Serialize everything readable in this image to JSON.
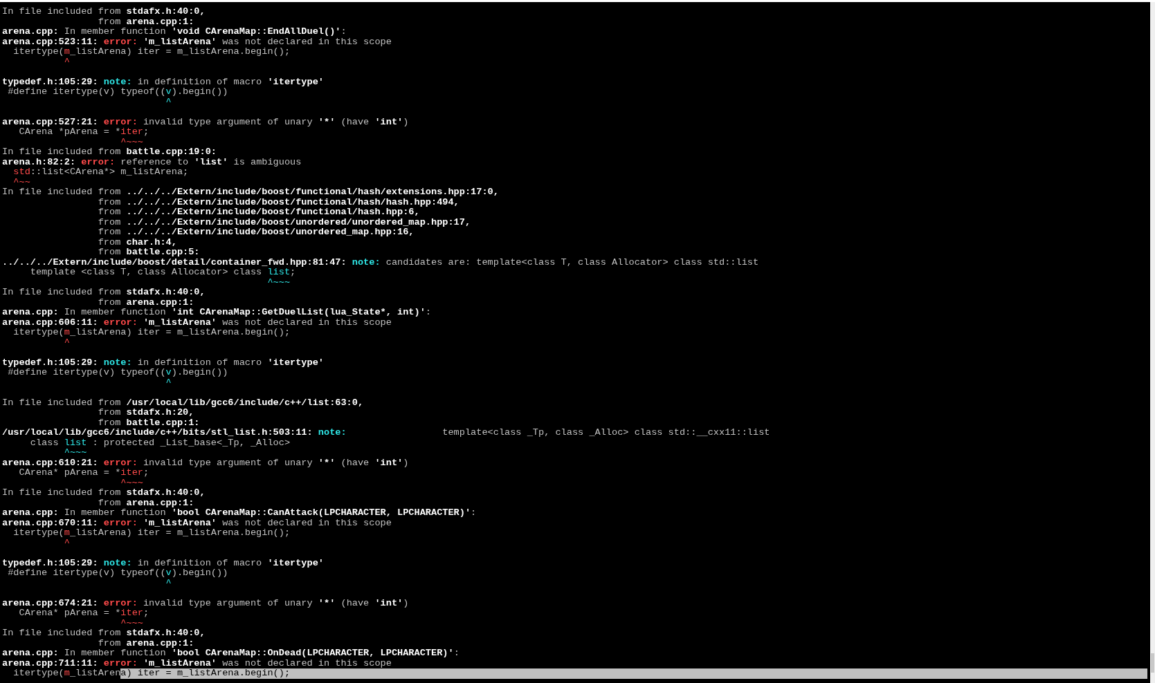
{
  "terminal": {
    "lines": [
      {
        "kind": "text",
        "spans": [
          {
            "kind": "plain",
            "text": "In file included from "
          },
          {
            "kind": "bold",
            "text": "stdafx.h:40:0,"
          }
        ]
      },
      {
        "kind": "text",
        "spans": [
          {
            "kind": "plain",
            "text": "                 from "
          },
          {
            "kind": "bold",
            "text": "arena.cpp:1:"
          }
        ]
      },
      {
        "kind": "text",
        "spans": [
          {
            "kind": "bold",
            "text": "arena.cpp:"
          },
          {
            "kind": "plain",
            "text": " In member function "
          },
          {
            "kind": "bold",
            "text": "'void CArenaMap::EndAllDuel()'"
          },
          {
            "kind": "plain",
            "text": ":"
          }
        ]
      },
      {
        "kind": "text",
        "spans": [
          {
            "kind": "bold",
            "text": "arena.cpp:523:11: "
          },
          {
            "kind": "error",
            "text": "error: "
          },
          {
            "kind": "bold",
            "text": "'m_listArena'"
          },
          {
            "kind": "plain",
            "text": " was not declared in this scope"
          }
        ]
      },
      {
        "kind": "text",
        "spans": [
          {
            "kind": "plain",
            "text": "  itertype("
          },
          {
            "kind": "red",
            "text": "m"
          },
          {
            "kind": "plain",
            "text": "_listArena) iter = m_listArena.begin();"
          }
        ]
      },
      {
        "kind": "text",
        "spans": [
          {
            "kind": "red",
            "text": "           ^"
          }
        ]
      },
      {
        "kind": "blank"
      },
      {
        "kind": "text",
        "spans": [
          {
            "kind": "bold",
            "text": "typedef.h:105:29: "
          },
          {
            "kind": "note",
            "text": "note: "
          },
          {
            "kind": "plain",
            "text": "in definition of macro "
          },
          {
            "kind": "bold",
            "text": "'itertype'"
          }
        ]
      },
      {
        "kind": "text",
        "spans": [
          {
            "kind": "plain",
            "text": " #define itertype(v) typeof(("
          },
          {
            "kind": "cyan",
            "text": "v"
          },
          {
            "kind": "plain",
            "text": ").begin())"
          }
        ]
      },
      {
        "kind": "text",
        "spans": [
          {
            "kind": "cyan",
            "text": "                             ^"
          }
        ]
      },
      {
        "kind": "blank"
      },
      {
        "kind": "text",
        "spans": [
          {
            "kind": "bold",
            "text": "arena.cpp:527:21: "
          },
          {
            "kind": "error",
            "text": "error: "
          },
          {
            "kind": "plain",
            "text": "invalid type argument of unary "
          },
          {
            "kind": "bold",
            "text": "'*'"
          },
          {
            "kind": "plain",
            "text": " (have "
          },
          {
            "kind": "bold",
            "text": "'int'"
          },
          {
            "kind": "plain",
            "text": ")"
          }
        ]
      },
      {
        "kind": "text",
        "spans": [
          {
            "kind": "plain",
            "text": "   CArena *pArena = *"
          },
          {
            "kind": "red",
            "text": "iter"
          },
          {
            "kind": "plain",
            "text": ";"
          }
        ]
      },
      {
        "kind": "text",
        "spans": [
          {
            "kind": "red",
            "text": "                     ^~~~"
          }
        ]
      },
      {
        "kind": "text",
        "spans": [
          {
            "kind": "plain",
            "text": "In file included from "
          },
          {
            "kind": "bold",
            "text": "battle.cpp:19:0:"
          }
        ]
      },
      {
        "kind": "text",
        "spans": [
          {
            "kind": "bold",
            "text": "arena.h:82:2: "
          },
          {
            "kind": "error",
            "text": "error: "
          },
          {
            "kind": "plain",
            "text": "reference to "
          },
          {
            "kind": "bold",
            "text": "'list'"
          },
          {
            "kind": "plain",
            "text": " is ambiguous"
          }
        ]
      },
      {
        "kind": "text",
        "spans": [
          {
            "kind": "red",
            "text": "  std"
          },
          {
            "kind": "plain",
            "text": "::list<CArena*> m_listArena;"
          }
        ]
      },
      {
        "kind": "text",
        "spans": [
          {
            "kind": "red",
            "text": "  ^~~"
          }
        ]
      },
      {
        "kind": "text",
        "spans": [
          {
            "kind": "plain",
            "text": "In file included from "
          },
          {
            "kind": "bold",
            "text": "../../../Extern/include/boost/functional/hash/extensions.hpp:17:0,"
          }
        ]
      },
      {
        "kind": "text",
        "spans": [
          {
            "kind": "plain",
            "text": "                 from "
          },
          {
            "kind": "bold",
            "text": "../../../Extern/include/boost/functional/hash/hash.hpp:494,"
          }
        ]
      },
      {
        "kind": "text",
        "spans": [
          {
            "kind": "plain",
            "text": "                 from "
          },
          {
            "kind": "bold",
            "text": "../../../Extern/include/boost/functional/hash.hpp:6,"
          }
        ]
      },
      {
        "kind": "text",
        "spans": [
          {
            "kind": "plain",
            "text": "                 from "
          },
          {
            "kind": "bold",
            "text": "../../../Extern/include/boost/unordered/unordered_map.hpp:17,"
          }
        ]
      },
      {
        "kind": "text",
        "spans": [
          {
            "kind": "plain",
            "text": "                 from "
          },
          {
            "kind": "bold",
            "text": "../../../Extern/include/boost/unordered_map.hpp:16,"
          }
        ]
      },
      {
        "kind": "text",
        "spans": [
          {
            "kind": "plain",
            "text": "                 from "
          },
          {
            "kind": "bold",
            "text": "char.h:4,"
          }
        ]
      },
      {
        "kind": "text",
        "spans": [
          {
            "kind": "plain",
            "text": "                 from "
          },
          {
            "kind": "bold",
            "text": "battle.cpp:5:"
          }
        ]
      },
      {
        "kind": "text",
        "spans": [
          {
            "kind": "bold",
            "text": "../../../Extern/include/boost/detail/container_fwd.hpp:81:47: "
          },
          {
            "kind": "note",
            "text": "note: "
          },
          {
            "kind": "plain",
            "text": "candidates are: template<class T, class Allocator> class std::list"
          }
        ]
      },
      {
        "kind": "text",
        "spans": [
          {
            "kind": "plain",
            "text": "     template <class T, class Allocator> class "
          },
          {
            "kind": "cyan",
            "text": "list"
          },
          {
            "kind": "plain",
            "text": ";"
          }
        ]
      },
      {
        "kind": "text",
        "spans": [
          {
            "kind": "cyan",
            "text": "                                               ^~~~"
          }
        ]
      },
      {
        "kind": "text",
        "spans": [
          {
            "kind": "plain",
            "text": "In file included from "
          },
          {
            "kind": "bold",
            "text": "stdafx.h:40:0,"
          }
        ]
      },
      {
        "kind": "text",
        "spans": [
          {
            "kind": "plain",
            "text": "                 from "
          },
          {
            "kind": "bold",
            "text": "arena.cpp:1:"
          }
        ]
      },
      {
        "kind": "text",
        "spans": [
          {
            "kind": "bold",
            "text": "arena.cpp:"
          },
          {
            "kind": "plain",
            "text": " In member function "
          },
          {
            "kind": "bold",
            "text": "'int CArenaMap::GetDuelList(lua_State*, int)'"
          },
          {
            "kind": "plain",
            "text": ":"
          }
        ]
      },
      {
        "kind": "text",
        "spans": [
          {
            "kind": "bold",
            "text": "arena.cpp:606:11: "
          },
          {
            "kind": "error",
            "text": "error: "
          },
          {
            "kind": "bold",
            "text": "'m_listArena'"
          },
          {
            "kind": "plain",
            "text": " was not declared in this scope"
          }
        ]
      },
      {
        "kind": "text",
        "spans": [
          {
            "kind": "plain",
            "text": "  itertype("
          },
          {
            "kind": "red",
            "text": "m"
          },
          {
            "kind": "plain",
            "text": "_listArena) iter = m_listArena.begin();"
          }
        ]
      },
      {
        "kind": "text",
        "spans": [
          {
            "kind": "red",
            "text": "           ^"
          }
        ]
      },
      {
        "kind": "blank"
      },
      {
        "kind": "text",
        "spans": [
          {
            "kind": "bold",
            "text": "typedef.h:105:29: "
          },
          {
            "kind": "note",
            "text": "note: "
          },
          {
            "kind": "plain",
            "text": "in definition of macro "
          },
          {
            "kind": "bold",
            "text": "'itertype'"
          }
        ]
      },
      {
        "kind": "text",
        "spans": [
          {
            "kind": "plain",
            "text": " #define itertype(v) typeof(("
          },
          {
            "kind": "cyan",
            "text": "v"
          },
          {
            "kind": "plain",
            "text": ").begin())"
          }
        ]
      },
      {
        "kind": "text",
        "spans": [
          {
            "kind": "cyan",
            "text": "                             ^"
          }
        ]
      },
      {
        "kind": "blank"
      },
      {
        "kind": "text",
        "spans": [
          {
            "kind": "plain",
            "text": "In file included from "
          },
          {
            "kind": "bold",
            "text": "/usr/local/lib/gcc6/include/c++/list:63:0,"
          }
        ]
      },
      {
        "kind": "text",
        "spans": [
          {
            "kind": "plain",
            "text": "                 from "
          },
          {
            "kind": "bold",
            "text": "stdafx.h:20,"
          }
        ]
      },
      {
        "kind": "text",
        "spans": [
          {
            "kind": "plain",
            "text": "                 from "
          },
          {
            "kind": "bold",
            "text": "battle.cpp:1:"
          }
        ]
      },
      {
        "kind": "text",
        "spans": [
          {
            "kind": "bold",
            "text": "/usr/local/lib/gcc6/include/c++/bits/stl_list.h:503:11: "
          },
          {
            "kind": "note",
            "text": "note: "
          },
          {
            "kind": "plain",
            "text": "                template<class _Tp, class _Alloc> class std::__cxx11::list"
          }
        ]
      },
      {
        "kind": "text",
        "spans": [
          {
            "kind": "plain",
            "text": "     class "
          },
          {
            "kind": "cyan",
            "text": "list"
          },
          {
            "kind": "plain",
            "text": " : protected _List_base<_Tp, _Alloc>"
          }
        ]
      },
      {
        "kind": "text",
        "spans": [
          {
            "kind": "cyan",
            "text": "           ^~~~"
          }
        ]
      },
      {
        "kind": "text",
        "spans": [
          {
            "kind": "bold",
            "text": "arena.cpp:610:21: "
          },
          {
            "kind": "error",
            "text": "error: "
          },
          {
            "kind": "plain",
            "text": "invalid type argument of unary "
          },
          {
            "kind": "bold",
            "text": "'*'"
          },
          {
            "kind": "plain",
            "text": " (have "
          },
          {
            "kind": "bold",
            "text": "'int'"
          },
          {
            "kind": "plain",
            "text": ")"
          }
        ]
      },
      {
        "kind": "text",
        "spans": [
          {
            "kind": "plain",
            "text": "   CArena* pArena = *"
          },
          {
            "kind": "red",
            "text": "iter"
          },
          {
            "kind": "plain",
            "text": ";"
          }
        ]
      },
      {
        "kind": "text",
        "spans": [
          {
            "kind": "red",
            "text": "                     ^~~~"
          }
        ]
      },
      {
        "kind": "text",
        "spans": [
          {
            "kind": "plain",
            "text": "In file included from "
          },
          {
            "kind": "bold",
            "text": "stdafx.h:40:0,"
          }
        ]
      },
      {
        "kind": "text",
        "spans": [
          {
            "kind": "plain",
            "text": "                 from "
          },
          {
            "kind": "bold",
            "text": "arena.cpp:1:"
          }
        ]
      },
      {
        "kind": "text",
        "spans": [
          {
            "kind": "bold",
            "text": "arena.cpp:"
          },
          {
            "kind": "plain",
            "text": " In member function "
          },
          {
            "kind": "bold",
            "text": "'bool CArenaMap::CanAttack(LPCHARACTER, LPCHARACTER)'"
          },
          {
            "kind": "plain",
            "text": ":"
          }
        ]
      },
      {
        "kind": "text",
        "spans": [
          {
            "kind": "bold",
            "text": "arena.cpp:670:11: "
          },
          {
            "kind": "error",
            "text": "error: "
          },
          {
            "kind": "bold",
            "text": "'m_listArena'"
          },
          {
            "kind": "plain",
            "text": " was not declared in this scope"
          }
        ]
      },
      {
        "kind": "text",
        "spans": [
          {
            "kind": "plain",
            "text": "  itertype("
          },
          {
            "kind": "red",
            "text": "m"
          },
          {
            "kind": "plain",
            "text": "_listArena) iter = m_listArena.begin();"
          }
        ]
      },
      {
        "kind": "text",
        "spans": [
          {
            "kind": "red",
            "text": "           ^"
          }
        ]
      },
      {
        "kind": "blank"
      },
      {
        "kind": "text",
        "spans": [
          {
            "kind": "bold",
            "text": "typedef.h:105:29: "
          },
          {
            "kind": "note",
            "text": "note: "
          },
          {
            "kind": "plain",
            "text": "in definition of macro "
          },
          {
            "kind": "bold",
            "text": "'itertype'"
          }
        ]
      },
      {
        "kind": "text",
        "spans": [
          {
            "kind": "plain",
            "text": " #define itertype(v) typeof(("
          },
          {
            "kind": "cyan",
            "text": "v"
          },
          {
            "kind": "plain",
            "text": ").begin())"
          }
        ]
      },
      {
        "kind": "text",
        "spans": [
          {
            "kind": "cyan",
            "text": "                             ^"
          }
        ]
      },
      {
        "kind": "blank"
      },
      {
        "kind": "text",
        "spans": [
          {
            "kind": "bold",
            "text": "arena.cpp:674:21: "
          },
          {
            "kind": "error",
            "text": "error: "
          },
          {
            "kind": "plain",
            "text": "invalid type argument of unary "
          },
          {
            "kind": "bold",
            "text": "'*'"
          },
          {
            "kind": "plain",
            "text": " (have "
          },
          {
            "kind": "bold",
            "text": "'int'"
          },
          {
            "kind": "plain",
            "text": ")"
          }
        ]
      },
      {
        "kind": "text",
        "spans": [
          {
            "kind": "plain",
            "text": "   CArena* pArena = *"
          },
          {
            "kind": "red",
            "text": "iter"
          },
          {
            "kind": "plain",
            "text": ";"
          }
        ]
      },
      {
        "kind": "text",
        "spans": [
          {
            "kind": "red",
            "text": "                     ^~~~"
          }
        ]
      },
      {
        "kind": "text",
        "spans": [
          {
            "kind": "plain",
            "text": "In file included from "
          },
          {
            "kind": "bold",
            "text": "stdafx.h:40:0,"
          }
        ]
      },
      {
        "kind": "text",
        "spans": [
          {
            "kind": "plain",
            "text": "                 from "
          },
          {
            "kind": "bold",
            "text": "arena.cpp:1:"
          }
        ]
      },
      {
        "kind": "text",
        "spans": [
          {
            "kind": "bold",
            "text": "arena.cpp:"
          },
          {
            "kind": "plain",
            "text": " In member function "
          },
          {
            "kind": "bold",
            "text": "'bool CArenaMap::OnDead(LPCHARACTER, LPCHARACTER)'"
          },
          {
            "kind": "plain",
            "text": ":"
          }
        ]
      },
      {
        "kind": "text",
        "spans": [
          {
            "kind": "bold",
            "text": "arena.cpp:711:11: "
          },
          {
            "kind": "error",
            "text": "error: "
          },
          {
            "kind": "bold",
            "text": "'m_listArena'"
          },
          {
            "kind": "plain",
            "text": " was not declared in this scope"
          }
        ]
      },
      {
        "kind": "text",
        "spans": [
          {
            "kind": "plain",
            "text": "  itertype(",
            "selected": false
          },
          {
            "kind": "red",
            "text": "m",
            "selected": false
          },
          {
            "kind": "plain",
            "text": "_listAren",
            "selected": false
          },
          {
            "kind": "plain",
            "text": "a) iter = m_listArena.begin();",
            "selected": true
          }
        ]
      }
    ]
  }
}
